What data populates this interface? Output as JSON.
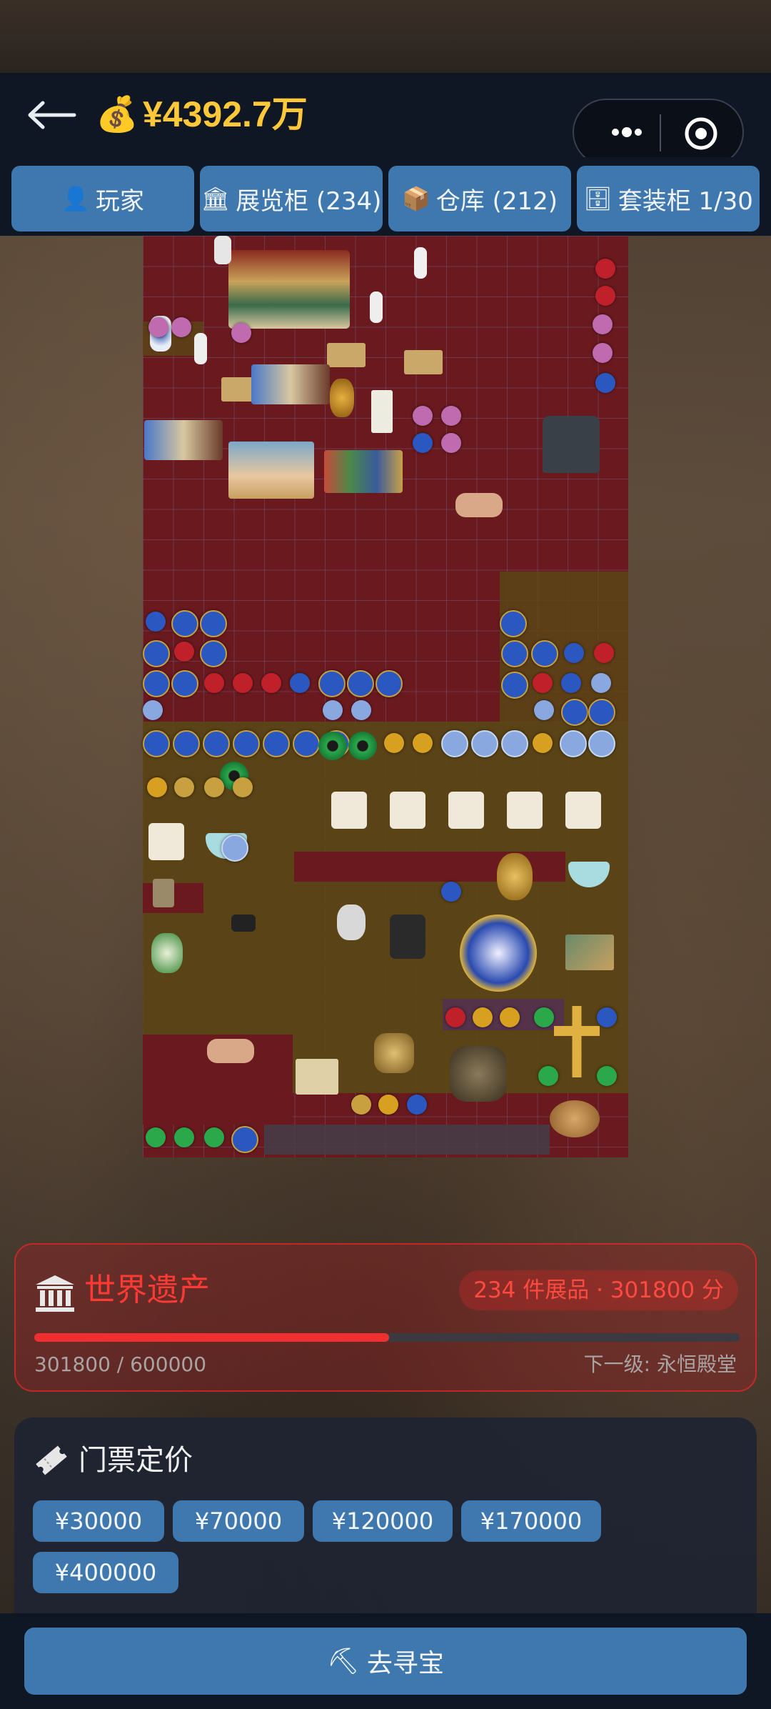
{
  "header": {
    "money_icon": "money-bag-icon",
    "money": "¥4392.7万"
  },
  "tabs": [
    {
      "icon": "player-icon",
      "label": "玩家"
    },
    {
      "icon": "museum-icon",
      "label": "展览柜 (234)"
    },
    {
      "icon": "box-icon",
      "label": "仓库 (212)"
    },
    {
      "icon": "cabinet-icon",
      "label": "套装柜 1/30"
    }
  ],
  "level": {
    "title": "世界遗产",
    "badge": "234 件展品 · 301800 分",
    "progress_text": "301800 / 600000",
    "progress": 0.503,
    "next_level": "下一级: 永恒殿堂",
    "accent": "#ff3a34"
  },
  "ticket": {
    "title": "门票定价",
    "prices": [
      "¥30000",
      "¥70000",
      "¥120000",
      "¥170000",
      "¥400000"
    ]
  },
  "bottom": {
    "go_label": "去寻宝"
  },
  "colors": {
    "primary": "#3f78ae",
    "money": "#ffc83a",
    "cabinet_red": "#6a1a1f",
    "cabinet_olive": "#5a4616"
  }
}
